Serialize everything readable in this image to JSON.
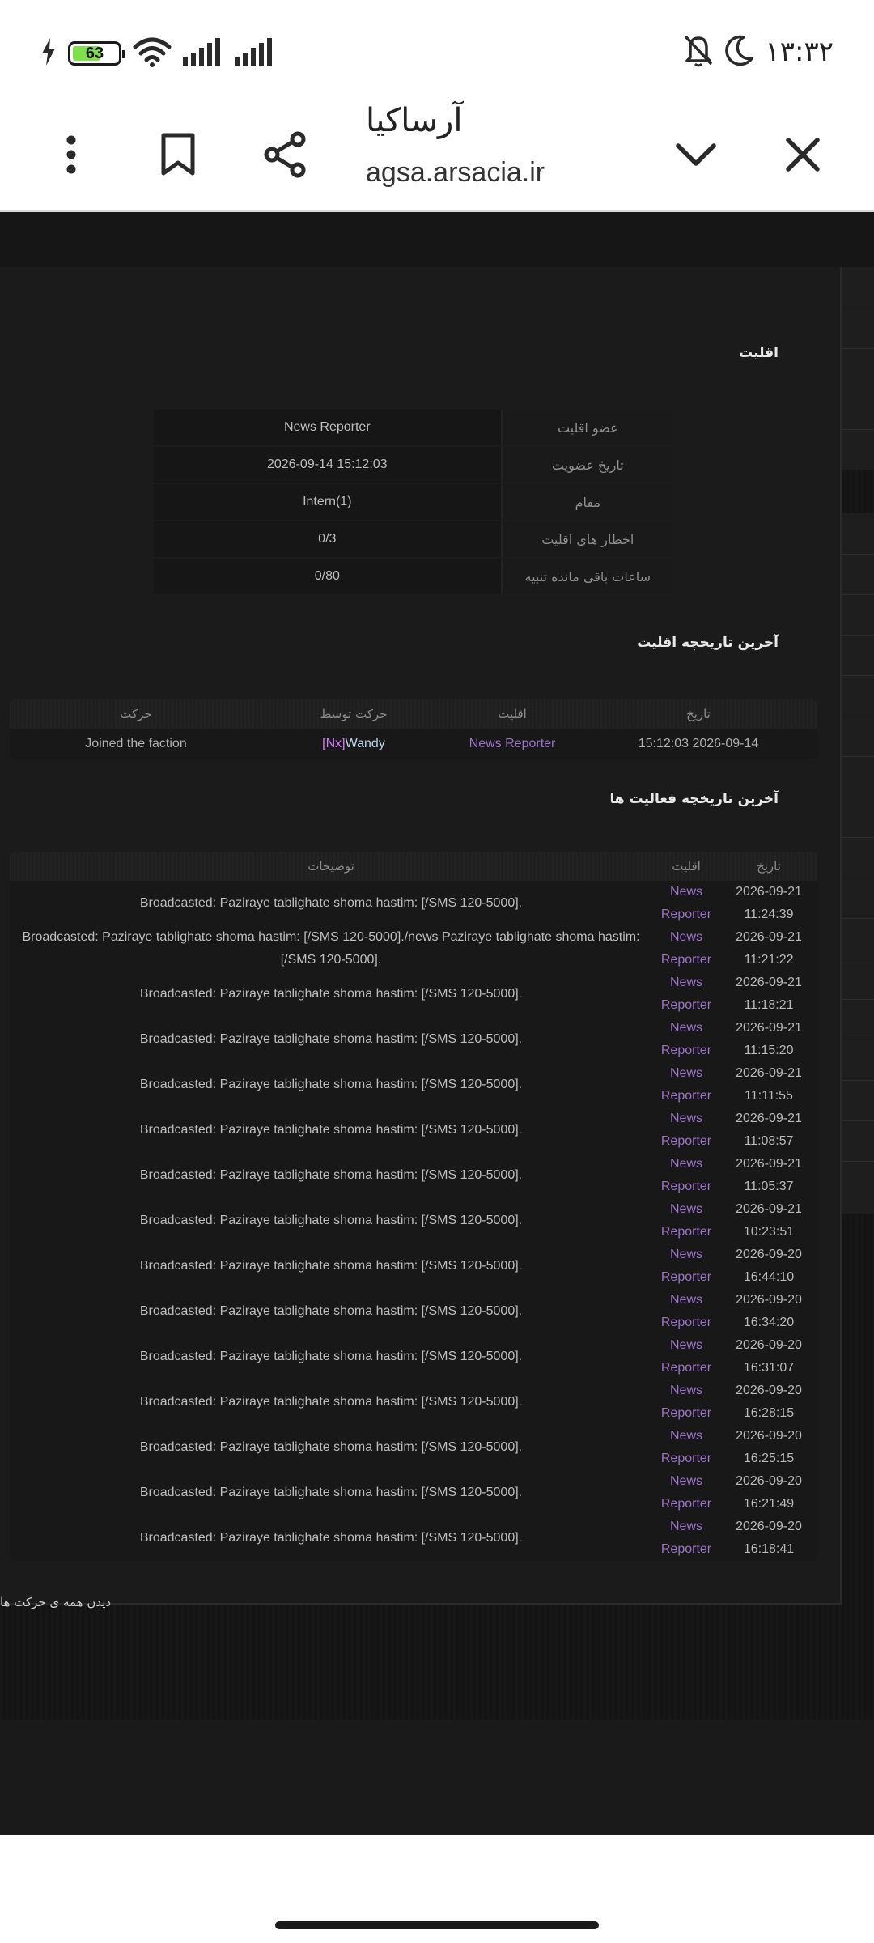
{
  "status_bar": {
    "time": "۱۳:۳۲",
    "battery_level": "63",
    "battery_fraction": 0.63,
    "icons": [
      "charging-icon",
      "wifi-icon",
      "signal-icon",
      "signal-icon",
      "dnd-icon",
      "moon-icon"
    ]
  },
  "browser": {
    "title": "آرساکیا",
    "url": "agsa.arsacia.ir",
    "icons": [
      "close-icon",
      "chevron-down-icon",
      "share-icon",
      "bookmark-icon",
      "more-icon"
    ]
  },
  "faction": {
    "title": "اقلیت",
    "rows": [
      {
        "label": "عضو اقلیت",
        "value": "News Reporter"
      },
      {
        "label": "تاریخ عضویت",
        "value": "2026-09-14 15:12:03"
      },
      {
        "label": "مقام",
        "value": "Intern(1)"
      },
      {
        "label": "اخطار های اقلیت",
        "value": "0/3"
      },
      {
        "label": "ساعات باقی مانده تنبیه",
        "value": "0/80"
      }
    ]
  },
  "history": {
    "title": "آخرین تاریخچه اقلیت",
    "headers": {
      "date": "تاریخ",
      "faction": "اقلیت",
      "by": "حرکت توسط",
      "action": "حرکت"
    },
    "rows": [
      {
        "date": "2026-09-14 15:12:03",
        "faction": "News Reporter",
        "by_tag": "[Nx]",
        "by_name": "Wandy",
        "action": "Joined the faction"
      }
    ]
  },
  "activity": {
    "title": "آخرین تاریخچه فعالیت ها",
    "headers": {
      "date": "تاریخ",
      "faction": "اقلیت",
      "description": "توضیحات"
    },
    "rows": [
      {
        "date": "2026-09-21",
        "time": "11:24:39",
        "faction_a": "News",
        "faction_b": "Reporter",
        "description": "Broadcasted: Paziraye tablighate shoma hastim: [/SMS 120-5000]."
      },
      {
        "date": "2026-09-21",
        "time": "11:21:22",
        "faction_a": "News",
        "faction_b": "Reporter",
        "description": "Broadcasted: Paziraye tablighate shoma hastim: [/SMS 120-5000]./news Paziraye tablighate shoma hastim: [/SMS 120-5000]."
      },
      {
        "date": "2026-09-21",
        "time": "11:18:21",
        "faction_a": "News",
        "faction_b": "Reporter",
        "description": "Broadcasted: Paziraye tablighate shoma hastim: [/SMS 120-5000]."
      },
      {
        "date": "2026-09-21",
        "time": "11:15:20",
        "faction_a": "News",
        "faction_b": "Reporter",
        "description": "Broadcasted: Paziraye tablighate shoma hastim: [/SMS 120-5000]."
      },
      {
        "date": "2026-09-21",
        "time": "11:11:55",
        "faction_a": "News",
        "faction_b": "Reporter",
        "description": "Broadcasted: Paziraye tablighate shoma hastim: [/SMS 120-5000]."
      },
      {
        "date": "2026-09-21",
        "time": "11:08:57",
        "faction_a": "News",
        "faction_b": "Reporter",
        "description": "Broadcasted: Paziraye tablighate shoma hastim: [/SMS 120-5000]."
      },
      {
        "date": "2026-09-21",
        "time": "11:05:37",
        "faction_a": "News",
        "faction_b": "Reporter",
        "description": "Broadcasted: Paziraye tablighate shoma hastim: [/SMS 120-5000]."
      },
      {
        "date": "2026-09-21",
        "time": "10:23:51",
        "faction_a": "News",
        "faction_b": "Reporter",
        "description": "Broadcasted: Paziraye tablighate shoma hastim: [/SMS 120-5000]."
      },
      {
        "date": "2026-09-20",
        "time": "16:44:10",
        "faction_a": "News",
        "faction_b": "Reporter",
        "description": "Broadcasted: Paziraye tablighate shoma hastim: [/SMS 120-5000]."
      },
      {
        "date": "2026-09-20",
        "time": "16:34:20",
        "faction_a": "News",
        "faction_b": "Reporter",
        "description": "Broadcasted: Paziraye tablighate shoma hastim: [/SMS 120-5000]."
      },
      {
        "date": "2026-09-20",
        "time": "16:31:07",
        "faction_a": "News",
        "faction_b": "Reporter",
        "description": "Broadcasted: Paziraye tablighate shoma hastim: [/SMS 120-5000]."
      },
      {
        "date": "2026-09-20",
        "time": "16:28:15",
        "faction_a": "News",
        "faction_b": "Reporter",
        "description": "Broadcasted: Paziraye tablighate shoma hastim: [/SMS 120-5000]."
      },
      {
        "date": "2026-09-20",
        "time": "16:25:15",
        "faction_a": "News",
        "faction_b": "Reporter",
        "description": "Broadcasted: Paziraye tablighate shoma hastim: [/SMS 120-5000]."
      },
      {
        "date": "2026-09-20",
        "time": "16:21:49",
        "faction_a": "News",
        "faction_b": "Reporter",
        "description": "Broadcasted: Paziraye tablighate shoma hastim: [/SMS 120-5000]."
      },
      {
        "date": "2026-09-20",
        "time": "16:18:41",
        "faction_a": "News",
        "faction_b": "Reporter",
        "description": "Broadcasted: Paziraye tablighate shoma hastim: [/SMS 120-5000]."
      }
    ],
    "see_all": "دیدن همه ی حرکت ها"
  },
  "colors": {
    "page_bg": "#141414",
    "panel_bg": "#1b1b1b",
    "faction_purple": "#9a72c8",
    "tag_purple": "#d47cff",
    "battery_green": "#7ee04b"
  }
}
